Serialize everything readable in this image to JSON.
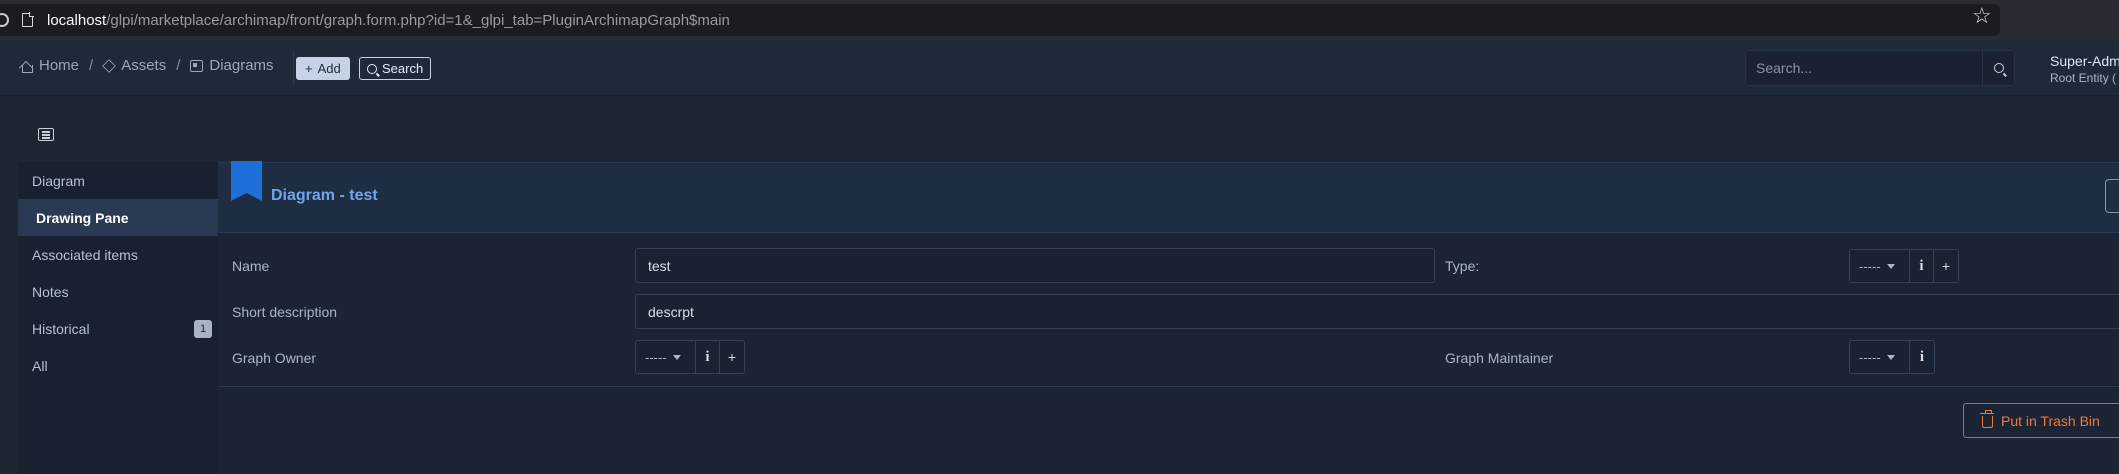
{
  "browser": {
    "url_host": "localhost",
    "url_path": "/glpi/marketplace/archimap/front/graph.form.php?id=1&_glpi_tab=PluginArchimapGraph$main"
  },
  "header": {
    "breadcrumb": [
      {
        "label": "Home",
        "icon": "home-icon"
      },
      {
        "label": "Assets",
        "icon": "cube-icon"
      },
      {
        "label": "Diagrams",
        "icon": "diagram-icon"
      }
    ],
    "add_label": "Add",
    "search_label": "Search",
    "global_search_placeholder": "Search...",
    "user_name": "Super-Adm",
    "user_entity": "Root Entity ("
  },
  "tabs": [
    {
      "label": "Diagram",
      "active": false
    },
    {
      "label": "Drawing Pane",
      "active": true
    },
    {
      "label": "Associated items",
      "active": false
    },
    {
      "label": "Notes",
      "active": false
    },
    {
      "label": "Historical",
      "active": false,
      "badge": "1"
    },
    {
      "label": "All",
      "active": false
    }
  ],
  "card": {
    "title": "Diagram - test",
    "fields": {
      "name_label": "Name",
      "name_value": "test",
      "type_label": "Type:",
      "type_value": "-----",
      "short_desc_label": "Short description",
      "short_desc_value": "descrpt",
      "owner_label": "Graph Owner",
      "owner_value": "-----",
      "maintainer_label": "Graph Maintainer",
      "maintainer_value": "-----"
    },
    "trash_label": "Put in Trash Bin"
  },
  "colors": {
    "accent": "#1e6fd9",
    "title": "#6fa5ef",
    "danger": "#ef7a3c"
  }
}
